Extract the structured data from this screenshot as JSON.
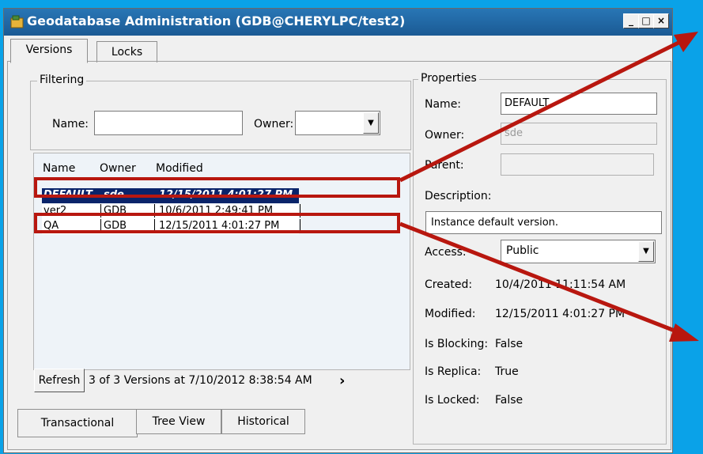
{
  "window": {
    "title": "Geodatabase Administration (GDB@CHERYLPC/test2)",
    "minimize": "_",
    "maximize": "□",
    "close": "×"
  },
  "top_tabs": [
    "Versions",
    "Locks"
  ],
  "filtering": {
    "legend": "Filtering",
    "name_label": "Name:",
    "owner_label": "Owner:",
    "name_value": "",
    "owner_value": ""
  },
  "versions_table": {
    "columns": [
      "Name",
      "Owner",
      "Modified"
    ],
    "rows": [
      {
        "name": "DEFAULT",
        "owner": "sde",
        "modified": "12/15/2011 4:01:27 PM",
        "selected": true
      },
      {
        "name": "ver2",
        "owner": "GDB",
        "modified": "10/6/2011 2:49:41 PM",
        "selected": false
      },
      {
        "name": "QA",
        "owner": "GDB",
        "modified": "12/15/2011 4:01:27 PM",
        "selected": false
      }
    ]
  },
  "refresh_label": "Refresh",
  "status_text": "3 of 3 Versions at 7/10/2012 8:38:54 AM",
  "more_glyph": "›",
  "bottom_tabs": [
    "Transactional",
    "Tree View",
    "Historical"
  ],
  "properties": {
    "legend": "Properties",
    "name_label": "Name:",
    "name_value": "DEFAULT",
    "owner_label": "Owner:",
    "owner_value": "sde",
    "parent_label": "Parent:",
    "parent_value": "",
    "description_label": "Description:",
    "description_value": "Instance default version.",
    "access_label": "Access:",
    "access_value": "Public",
    "created_label": "Created:",
    "created_value": "10/4/2011 11:11:54 AM",
    "modified_label": "Modified:",
    "modified_value": "12/15/2011 4:01:27 PM",
    "blocking_label": "Is Blocking:",
    "blocking_value": "False",
    "replica_label": "Is Replica:",
    "replica_value": "True",
    "locked_label": "Is Locked:",
    "locked_value": "False"
  },
  "colors": {
    "background": "#0aa2e8",
    "titlebar": "#1f65a3",
    "selection": "#0a246a",
    "annotation": "#b8170f"
  }
}
